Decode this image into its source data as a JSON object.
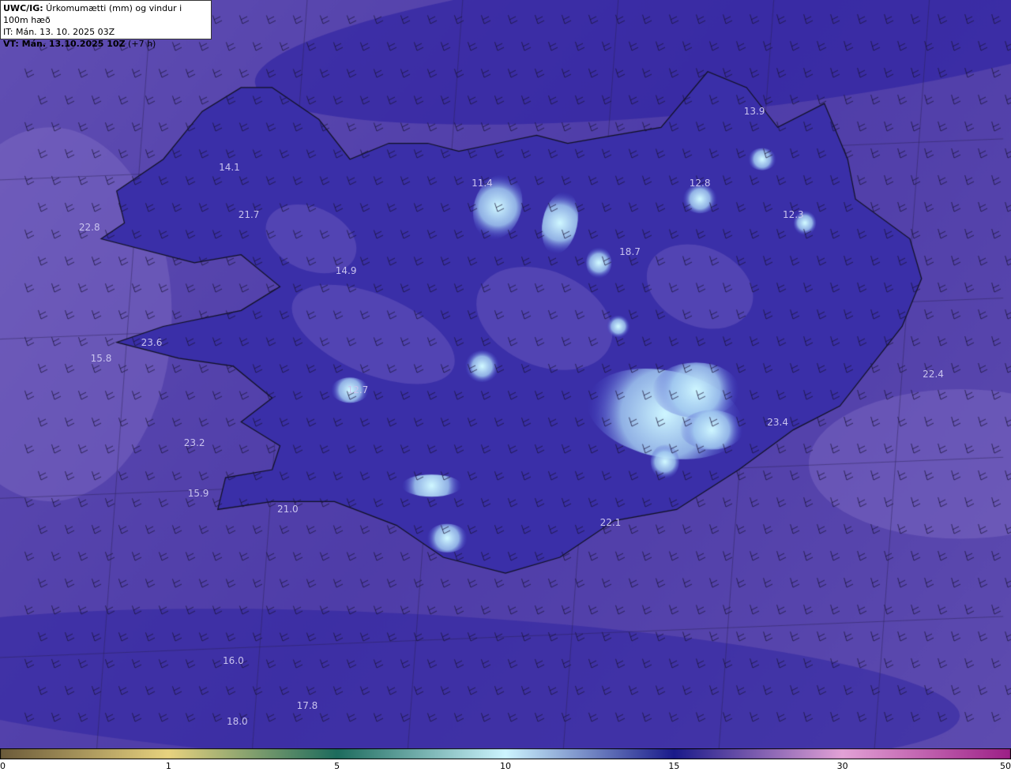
{
  "header": {
    "model": "UWC/IG:",
    "title": " Úrkomumætti (mm) og vindur i 100m hæð",
    "it_line": "IT: Mán. 13. 10. 2025 03Z",
    "vt_prefix": "VT: Mán. 13.10.2025 10Z",
    "vt_suffix": " (+7 h)"
  },
  "stations": [
    {
      "value": "14.1",
      "lon": -22.55,
      "lat": 65.95
    },
    {
      "value": "13.9",
      "lon": -15.8,
      "lat": 66.3
    },
    {
      "value": "11.4",
      "lon": -19.3,
      "lat": 65.85
    },
    {
      "value": "12.8",
      "lon": -16.5,
      "lat": 65.85
    },
    {
      "value": "22.8",
      "lon": -24.35,
      "lat": 65.57
    },
    {
      "value": "21.7",
      "lon": -22.3,
      "lat": 65.65
    },
    {
      "value": "12.3",
      "lon": -15.3,
      "lat": 65.65
    },
    {
      "value": "18.7",
      "lon": -17.4,
      "lat": 65.42
    },
    {
      "value": "14.9",
      "lon": -21.05,
      "lat": 65.3
    },
    {
      "value": "23.6",
      "lon": -23.55,
      "lat": 64.85
    },
    {
      "value": "15.8",
      "lon": -24.2,
      "lat": 64.75
    },
    {
      "value": "22.4",
      "lon": -13.5,
      "lat": 64.65
    },
    {
      "value": "12.7",
      "lon": -20.9,
      "lat": 64.55
    },
    {
      "value": "23.4",
      "lon": -15.5,
      "lat": 64.35
    },
    {
      "value": "23.2",
      "lon": -23.0,
      "lat": 64.22
    },
    {
      "value": "15.9",
      "lon": -22.95,
      "lat": 63.9
    },
    {
      "value": "21.0",
      "lon": -21.8,
      "lat": 63.8
    },
    {
      "value": "22.1",
      "lon": -17.65,
      "lat": 63.72
    },
    {
      "value": "16.0",
      "lon": -22.5,
      "lat": 62.85
    },
    {
      "value": "17.8",
      "lon": -21.55,
      "lat": 62.57
    },
    {
      "value": "18.0",
      "lon": -22.45,
      "lat": 62.47
    }
  ],
  "colorbar": {
    "ticks": [
      "0",
      "1",
      "5",
      "10",
      "15",
      "30",
      "50"
    ],
    "stops": [
      {
        "value": 0,
        "color": "#6b5a3a"
      },
      {
        "value": 1,
        "color": "#e8d37f"
      },
      {
        "value": 5,
        "color": "#1d6b5d"
      },
      {
        "value": 10,
        "color": "#cdf5ff"
      },
      {
        "value": 15,
        "color": "#1a1a8a"
      },
      {
        "value": 30,
        "color": "#e3a2d6"
      },
      {
        "value": 50,
        "color": "#9c1f86"
      }
    ]
  },
  "colors": {
    "ocean": "#5544a8",
    "land": "#3a2fa8",
    "heavy_precip": "#cdf5ff",
    "coastline": "#111122"
  },
  "map": {
    "lon_range": [
      -25.5,
      -12.5
    ],
    "lat_range": [
      62.3,
      67.0
    ]
  }
}
